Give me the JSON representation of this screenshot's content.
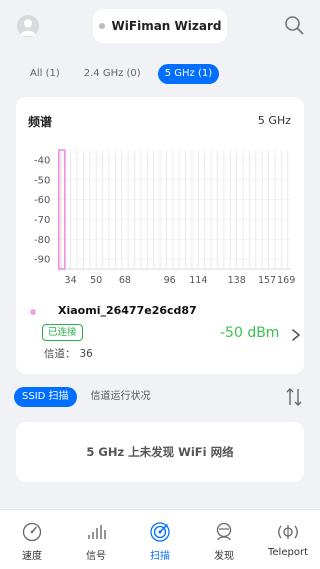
{
  "header": {
    "title": "WiFiman Wizard",
    "avatar_icon": "avatar-icon",
    "search_icon": "search-icon"
  },
  "band_filters": [
    {
      "label": "All (1)",
      "active": false
    },
    {
      "label": "2.4 GHz (0)",
      "active": false
    },
    {
      "label": "5 GHz (1)",
      "active": true
    }
  ],
  "spectrum": {
    "title": "频谱",
    "band_label": "5 GHz",
    "chart_data": {
      "type": "bar",
      "y_ticks": [
        "-40",
        "-50",
        "-60",
        "-70",
        "-80",
        "-90"
      ],
      "x_ticks": [
        "34",
        "50",
        "68",
        "96",
        "114",
        "138",
        "157",
        "169"
      ],
      "series": [
        {
          "channel": 36,
          "rssi": -50,
          "color": "#f08ee0"
        }
      ],
      "grid": true
    }
  },
  "network": {
    "ssid": "Xiaomi_26477e26cd87",
    "status": "已连接",
    "channel_label": "信道：",
    "channel_value": "36",
    "signal": "-50 dBm",
    "dot_color": "#f3a3e3"
  },
  "scan_tabs": [
    {
      "label": "SSID 扫描",
      "active": true
    },
    {
      "label": "信道运行状况",
      "active": false
    }
  ],
  "empty_message": "5 GHz 上未发现 WiFi 网络",
  "bottom_nav": [
    {
      "label": "速度",
      "icon": "speedometer-icon",
      "active": false
    },
    {
      "label": "信号",
      "icon": "signal-bars-icon",
      "active": false
    },
    {
      "label": "扫描",
      "icon": "scan-radar-icon",
      "active": true
    },
    {
      "label": "发现",
      "icon": "discover-icon",
      "active": false
    },
    {
      "label": "Teleport",
      "icon": "teleport-icon",
      "active": false
    }
  ],
  "colors": {
    "accent": "#006fff",
    "connected": "#27b24a",
    "signal_good": "#3cbf4f"
  }
}
